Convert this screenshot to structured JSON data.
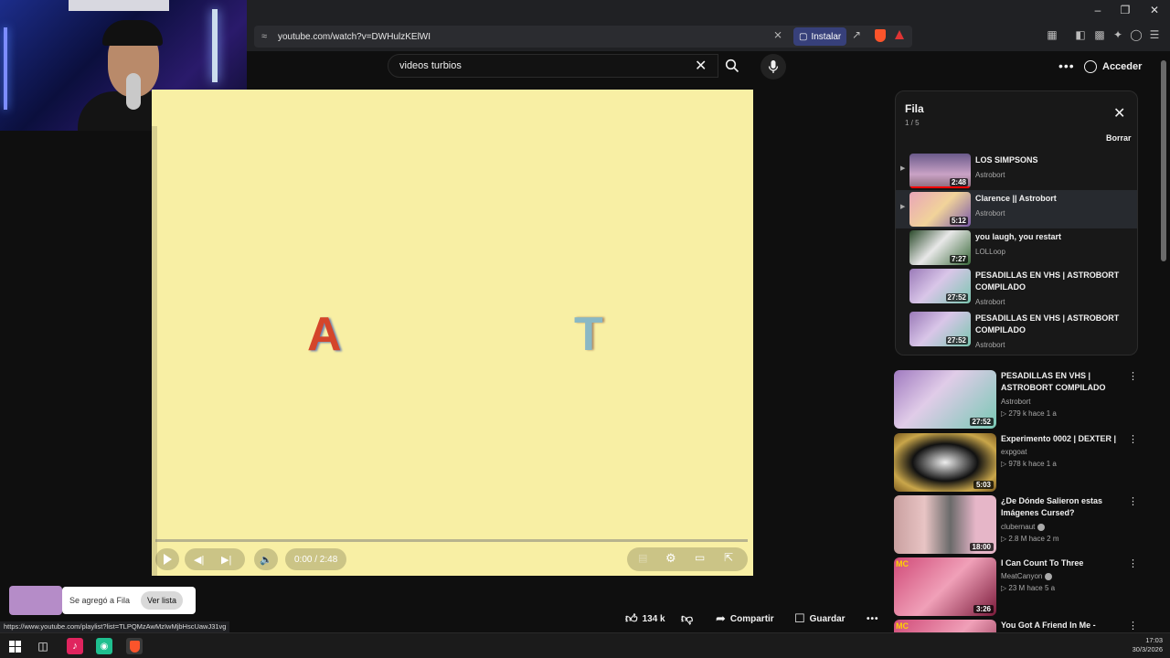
{
  "browser": {
    "url": "youtube.com/watch?v=DWHulzKElWI",
    "install_label": "Instalar",
    "status_url": "https://www.youtube.com/playlist?list=TLPQMzAwMzIwMjbHscUawJ31vg"
  },
  "header": {
    "search_value": "videos turbios",
    "signin_label": "Acceder"
  },
  "player": {
    "time": "0:00 / 2:48",
    "frame_letters": [
      "A",
      "T"
    ]
  },
  "queue": {
    "title": "Fila",
    "count": "1 / 5",
    "clear_label": "Borrar",
    "items": [
      {
        "title": "LOS SIMPSONS",
        "channel": "Astrobort",
        "duration": "2:48",
        "active": false
      },
      {
        "title": "Clarence || Astrobort",
        "channel": "Astrobort",
        "duration": "5:12",
        "active": true
      },
      {
        "title": "you laugh, you restart",
        "channel": "LOLLoop",
        "duration": "7:27",
        "active": false
      },
      {
        "title": "PESADILLAS EN VHS | ASTROBORT COMPILADO",
        "channel": "Astrobort",
        "duration": "27:52",
        "active": false
      },
      {
        "title": "PESADILLAS EN VHS | ASTROBORT COMPILADO",
        "channel": "Astrobort",
        "duration": "27:52",
        "active": false
      }
    ]
  },
  "recommendations": [
    {
      "title": "PESADILLAS EN VHS | ASTROBORT COMPILADO",
      "channel": "Astrobort",
      "meta": "▷ 279 k  hace 1 a",
      "duration": "27:52"
    },
    {
      "title": "Experimento 0002 | DEXTER |",
      "channel": "expgoat",
      "meta": "▷ 978 k  hace 1 a",
      "duration": "5:03"
    },
    {
      "title": "¿De Dónde Salieron estas Imágenes Cursed?",
      "channel": "clubernaut",
      "meta": "▷ 2.8 M  hace 2 m",
      "duration": "18:00"
    },
    {
      "title": "I Can Count To Three",
      "channel": "MeatCanyon",
      "meta": "▷ 23 M  hace 5 a",
      "duration": "3:26"
    },
    {
      "title": "You Got A Friend In Me -",
      "channel": "",
      "meta": "",
      "duration": ""
    }
  ],
  "actions": {
    "likes": "134 k",
    "share": "Compartir",
    "save": "Guardar"
  },
  "toast": {
    "message": "Se agregó a Fila",
    "button": "Ver lista"
  },
  "taskbar": {
    "time": "17:03",
    "date": "30/3/2026"
  },
  "colors": {
    "accent": "#ff0000",
    "background": "#0f0f0f",
    "player_frame": "#f8efa4"
  }
}
